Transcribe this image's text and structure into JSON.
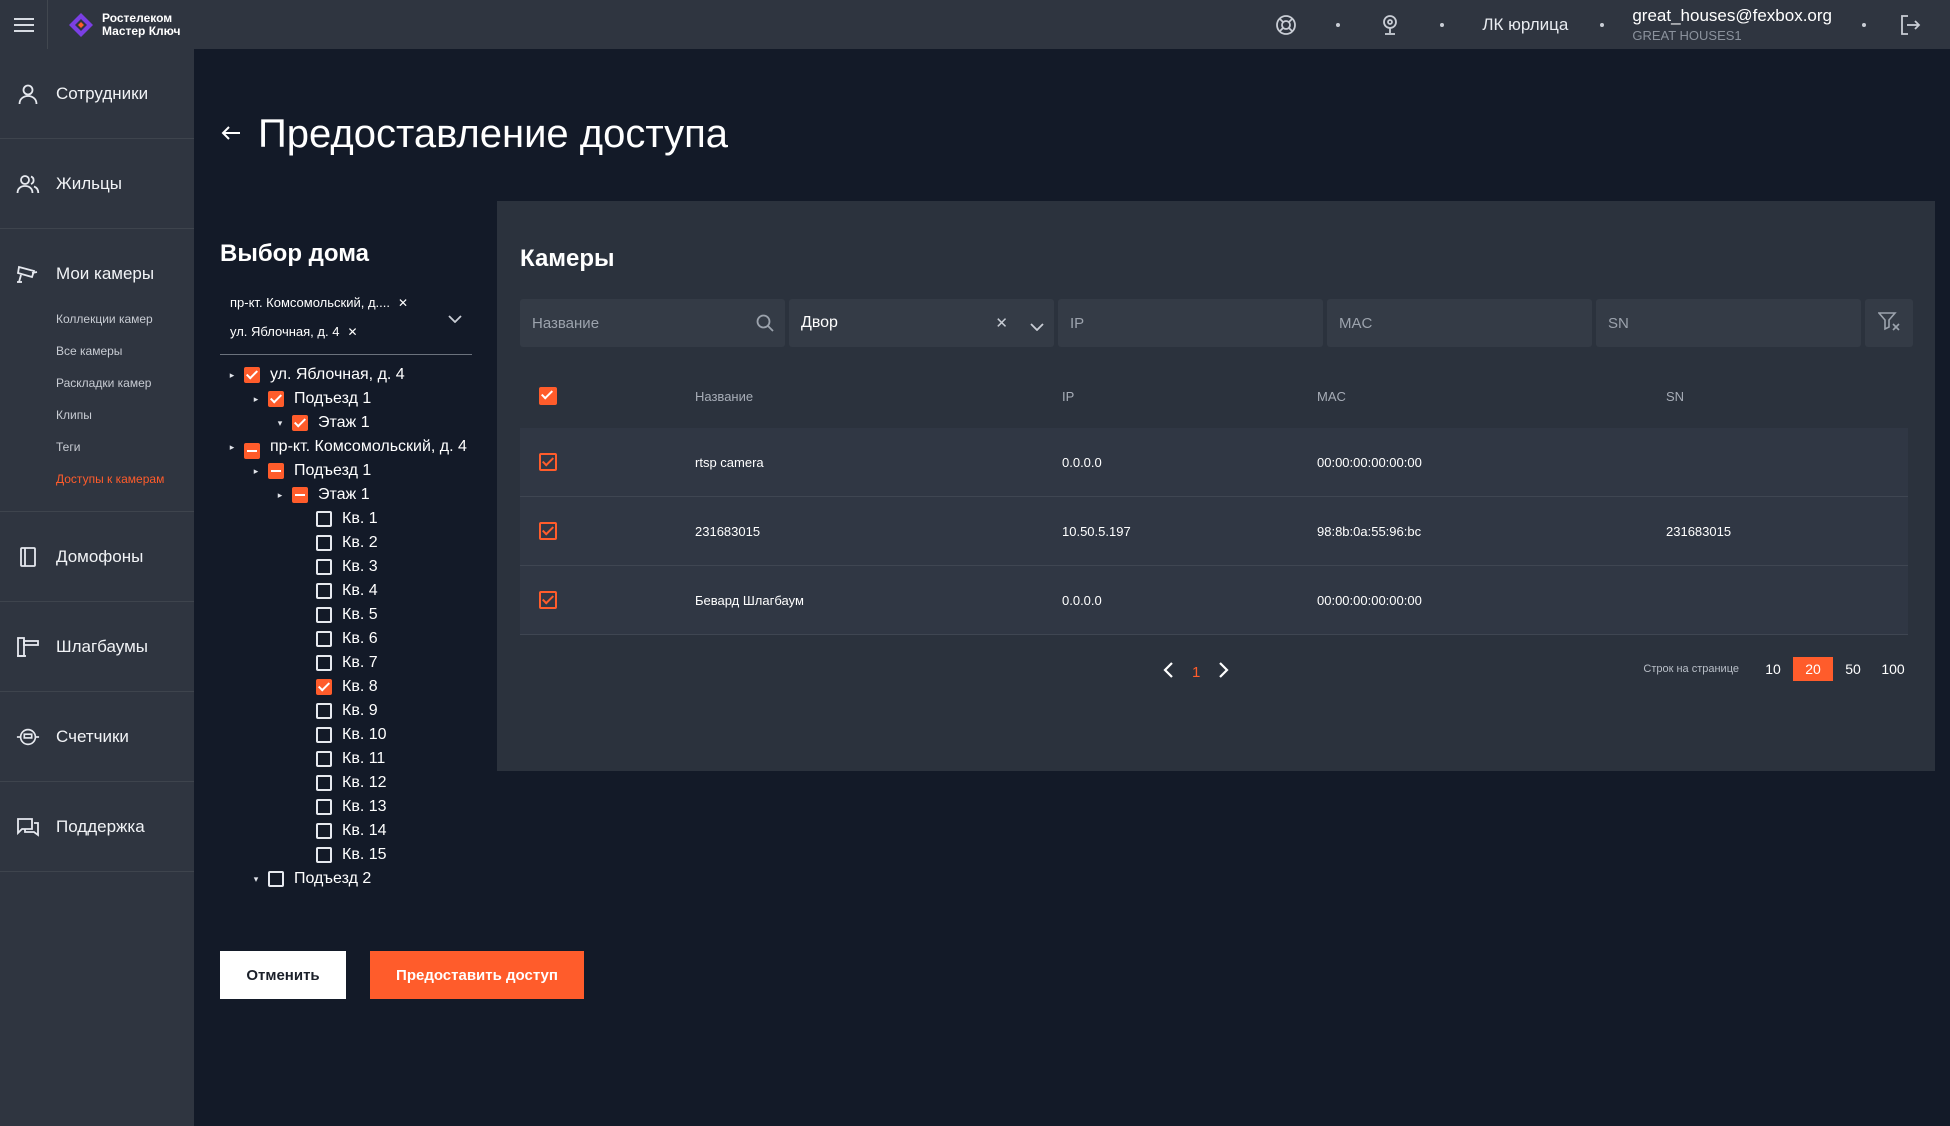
{
  "topbar": {
    "brand_line1": "Ростелеком",
    "brand_line2": "Мастер Ключ",
    "lk_label": "ЛК юрлица",
    "user_email": "great_houses@fexbox.org",
    "user_org": "GREAT HOUSES1",
    "icons": [
      "menu-icon",
      "support-lifebuoy-icon",
      "intercom-icon",
      "logout-icon"
    ]
  },
  "sidebar": {
    "items": [
      {
        "label": "Сотрудники",
        "icon": "person-icon"
      },
      {
        "label": "Жильцы",
        "icon": "people-icon"
      },
      {
        "label": "Мои камеры",
        "icon": "camera-icon"
      },
      {
        "label": "Домофоны",
        "icon": "intercom-icon"
      },
      {
        "label": "Шлагбаумы",
        "icon": "barrier-icon"
      },
      {
        "label": "Счетчики",
        "icon": "meter-icon"
      },
      {
        "label": "Поддержка",
        "icon": "chat-icon"
      }
    ],
    "camera_sub": [
      "Коллекции камер",
      "Все камеры",
      "Раскладки камер",
      "Клипы",
      "Теги",
      "Доступы к камерам"
    ]
  },
  "page": {
    "title": "Предоставление доступа"
  },
  "house": {
    "title": "Выбор дома",
    "chips": [
      "пр-кт. Комсомольский, д....",
      "ул. Яблочная, д. 4"
    ],
    "tree": [
      {
        "label": "ул. Яблочная, д. 4",
        "state": "on",
        "arrow": "▸"
      },
      {
        "label": "Подъезд 1",
        "state": "on",
        "arrow": "▸"
      },
      {
        "label": "Этаж 1",
        "state": "on",
        "arrow": "▾"
      },
      {
        "label": "пр-кт. Комсомольский, д. 4",
        "state": "part",
        "arrow": "▸"
      },
      {
        "label": "Подъезд 1",
        "state": "part",
        "arrow": "▸"
      },
      {
        "label": "Этаж 1",
        "state": "part",
        "arrow": "▸"
      },
      {
        "label": "Кв. 1",
        "state": "off"
      },
      {
        "label": "Кв. 2",
        "state": "off"
      },
      {
        "label": "Кв. 3",
        "state": "off"
      },
      {
        "label": "Кв. 4",
        "state": "off"
      },
      {
        "label": "Кв. 5",
        "state": "off"
      },
      {
        "label": "Кв. 6",
        "state": "off"
      },
      {
        "label": "Кв. 7",
        "state": "off"
      },
      {
        "label": "Кв. 8",
        "state": "on"
      },
      {
        "label": "Кв. 9",
        "state": "off"
      },
      {
        "label": "Кв. 10",
        "state": "off"
      },
      {
        "label": "Кв. 11",
        "state": "off"
      },
      {
        "label": "Кв. 12",
        "state": "off"
      },
      {
        "label": "Кв. 13",
        "state": "off"
      },
      {
        "label": "Кв. 14",
        "state": "off"
      },
      {
        "label": "Кв. 15",
        "state": "off"
      },
      {
        "label": "Подъезд 2",
        "state": "off",
        "arrow": "▾"
      }
    ],
    "cancel_label": "Отменить",
    "grant_label": "Предоставить доступ"
  },
  "cameras": {
    "title": "Камеры",
    "filters": {
      "name_placeholder": "Название",
      "type_value": "Двор",
      "ip_placeholder": "IP",
      "mac_placeholder": "MAC",
      "sn_placeholder": "SN"
    },
    "columns": [
      "Название",
      "IP",
      "MAC",
      "SN"
    ],
    "rows": [
      {
        "name": "rtsp camera",
        "ip": "0.0.0.0",
        "mac": "00:00:00:00:00:00",
        "sn": ""
      },
      {
        "name": "231683015",
        "ip": "10.50.5.197",
        "mac": "98:8b:0a:55:96:bc",
        "sn": "231683015"
      },
      {
        "name": "Бевард Шлагбаум",
        "ip": "0.0.0.0",
        "mac": "00:00:00:00:00:00",
        "sn": ""
      }
    ],
    "pagination": {
      "current_page": "1",
      "rows_label": "Строк на странице",
      "options": [
        "10",
        "20",
        "50",
        "100"
      ],
      "selected": "20"
    }
  },
  "colors": {
    "accent": "#ff5c2b",
    "background": "#131a28",
    "sidebar": "#2f3540",
    "panel": "#2b323d"
  }
}
